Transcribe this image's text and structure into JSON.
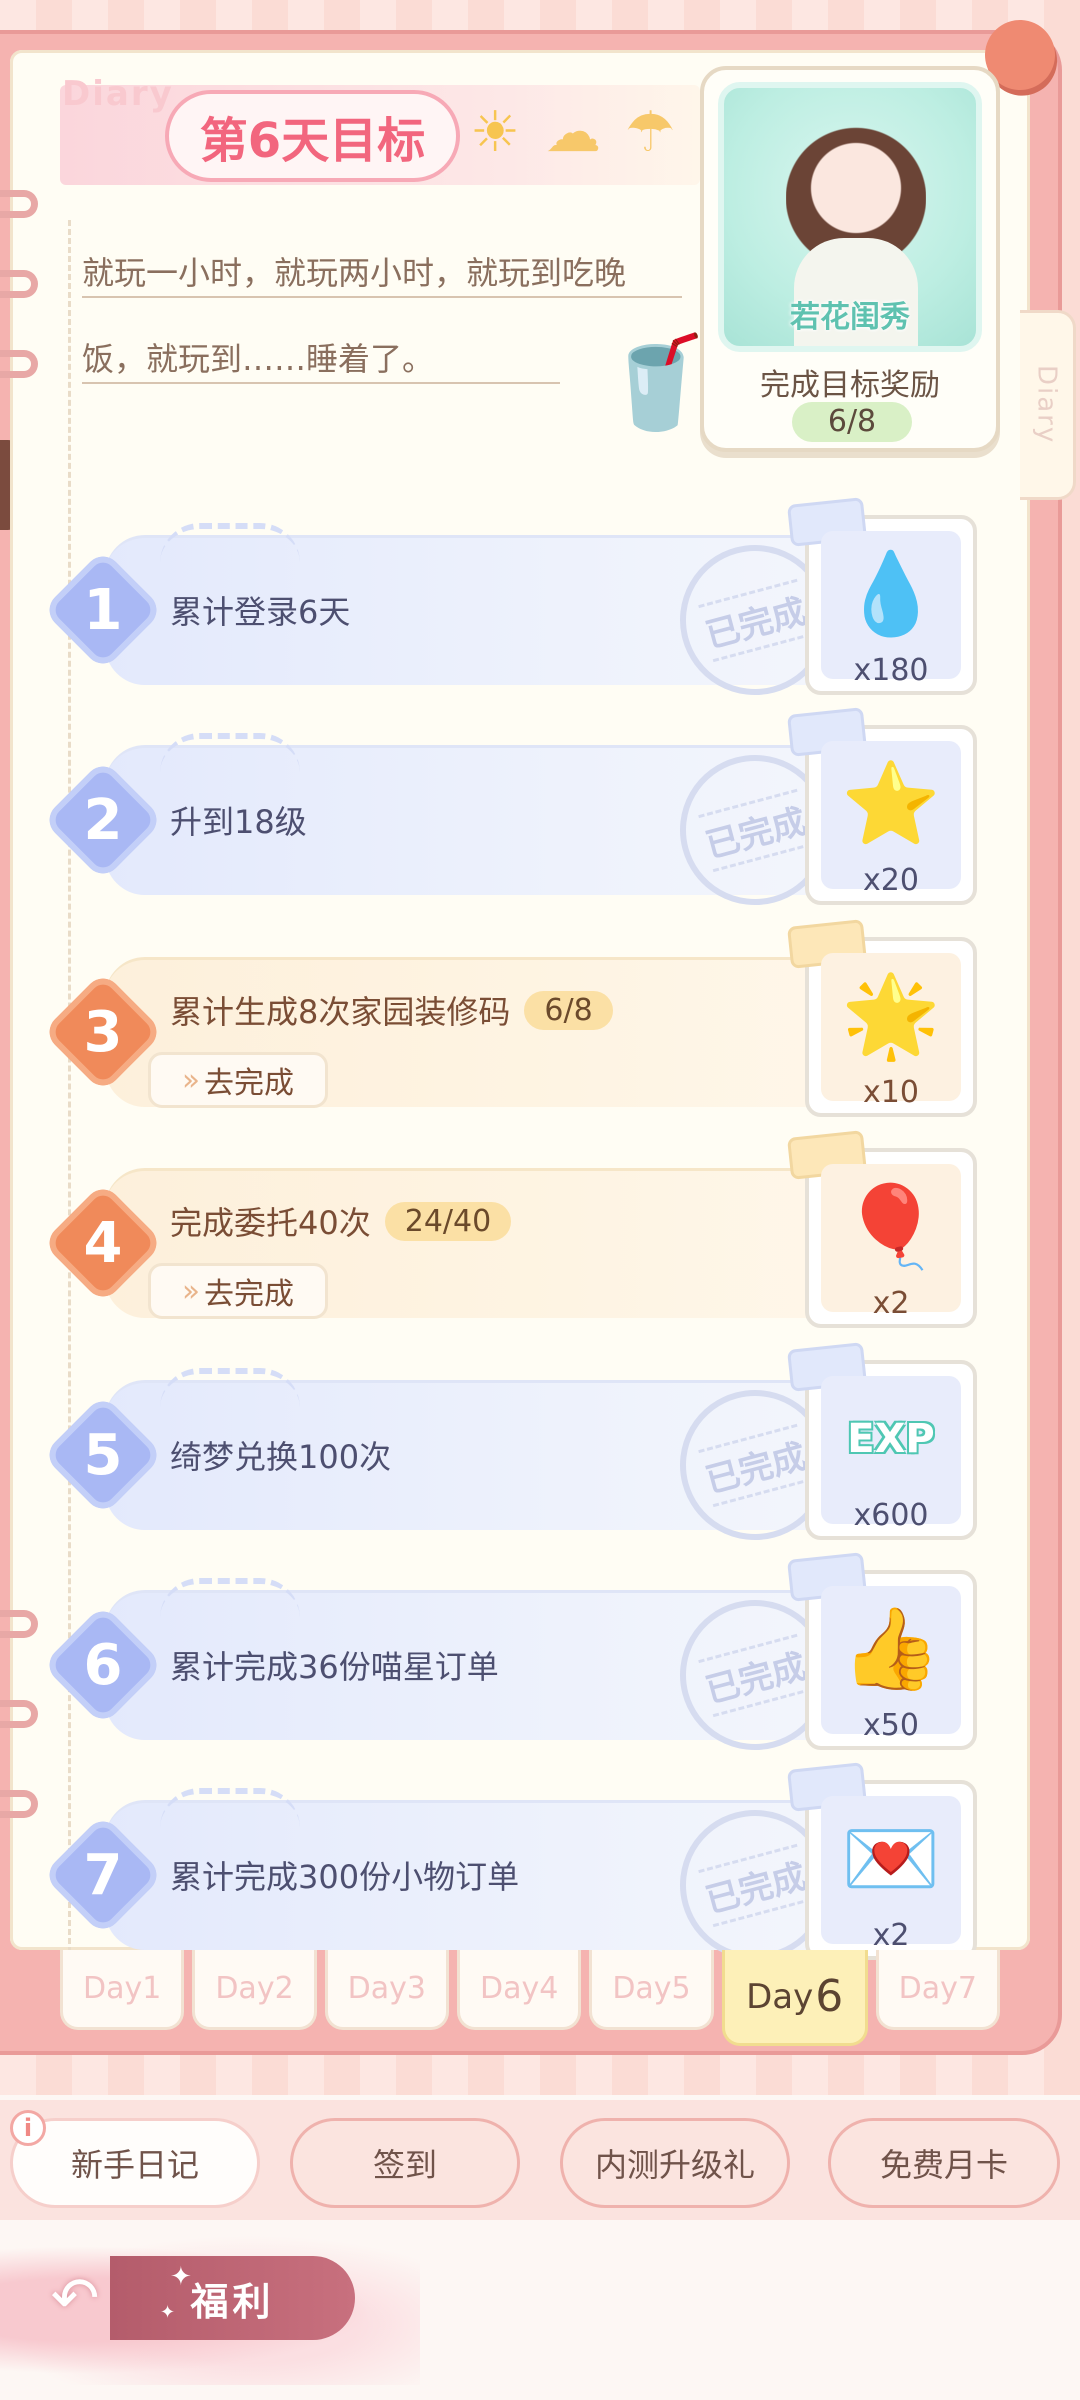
{
  "header": {
    "diary_word": "Diary",
    "title": "第6天目标",
    "weather_icons": [
      "sun-icon",
      "cloud-icon",
      "rain-cloud-icon"
    ]
  },
  "description": {
    "line1": "就玩一小时，就玩两小时，就玩到吃晚",
    "line2": "饭，就玩到……睡着了。"
  },
  "reward_card": {
    "avatar_name": "若花闺秀",
    "label": "完成目标奖励",
    "progress": "6/8"
  },
  "side_tab": "Diary",
  "tasks": [
    {
      "num": "1",
      "title": "累计登录6天",
      "status": "done",
      "done_label": "已完成",
      "reward_icon": "water-drop-icon",
      "reward_glyph": "💧",
      "reward_qty": "x180"
    },
    {
      "num": "2",
      "title": "升到18级",
      "status": "done",
      "done_label": "已完成",
      "reward_icon": "pink-star-icon",
      "reward_glyph": "⭐",
      "reward_qty": "x20"
    },
    {
      "num": "3",
      "title": "累计生成8次家园装修码",
      "status": "todo",
      "progress": "6/8",
      "go_label": "去完成",
      "reward_icon": "glowing-star-icon",
      "reward_glyph": "🌟",
      "reward_qty": "x10"
    },
    {
      "num": "4",
      "title": "完成委托40次",
      "status": "todo",
      "progress": "24/40",
      "go_label": "去完成",
      "reward_icon": "hot-air-balloon-icon",
      "reward_glyph": "🎈",
      "reward_qty": "x2"
    },
    {
      "num": "5",
      "title": "绮梦兑换100次",
      "status": "done",
      "done_label": "已完成",
      "reward_icon": "exp-badge-icon",
      "reward_glyph": "EXP",
      "reward_qty": "x600"
    },
    {
      "num": "6",
      "title": "累计完成36份喵星订单",
      "status": "done",
      "done_label": "已完成",
      "reward_icon": "thumbs-up-card-icon",
      "reward_glyph": "👍",
      "reward_qty": "x50"
    },
    {
      "num": "7",
      "title": "累计完成300份小物订单",
      "status": "done",
      "done_label": "已完成",
      "reward_icon": "like-envelope-icon",
      "reward_glyph": "💌",
      "reward_qty": "x2"
    }
  ],
  "day_tabs": [
    {
      "label": "Day1"
    },
    {
      "label": "Day2"
    },
    {
      "label": "Day3"
    },
    {
      "label": "Day4"
    },
    {
      "label": "Day5"
    },
    {
      "label": "Day",
      "num": "6",
      "active": true
    },
    {
      "label": "Day7"
    }
  ],
  "bottom_nav": {
    "items": [
      "新手日记",
      "签到",
      "内测升级礼",
      "免费月卡"
    ],
    "active": "新手日记",
    "info_icon": "i"
  },
  "welfare": {
    "label": "福利"
  }
}
